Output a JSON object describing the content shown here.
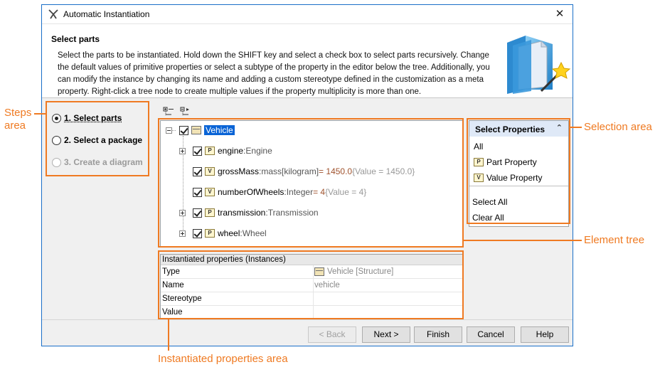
{
  "window": {
    "title": "Automatic Instantiation",
    "close": "✕"
  },
  "header": {
    "title": "Select parts",
    "description": "Select the parts to be instantiated. Hold down the SHIFT key and select a check box to select parts recursively. Change the default values of primitive properties or select a subtype of the property in the editor below the tree. Additionally, you can modify the instance by changing its name and adding a custom stereotype defined in the customization as a meta property. Right-click a tree node to create multiple values if the property multiplicity is more than one."
  },
  "steps": [
    {
      "label": "1. Select parts",
      "selected": true,
      "enabled": true
    },
    {
      "label": "2. Select a package",
      "selected": false,
      "enabled": true
    },
    {
      "label": "3. Create a diagram",
      "selected": false,
      "enabled": false
    }
  ],
  "toolbar": {
    "expand_icon": "expand-all-icon",
    "collapse_icon": "collapse-all-icon"
  },
  "tree": {
    "root": {
      "name": "Vehicle",
      "checked": true,
      "expanded": true
    },
    "nodes": [
      {
        "name": "engine",
        "sep": " : ",
        "type": "Engine",
        "icon": "P",
        "expandable": true,
        "value": "",
        "hint": ""
      },
      {
        "name": "grossMass",
        "sep": " : ",
        "type": "mass[kilogram]",
        "icon": "V",
        "expandable": false,
        "value": " = 1450.0",
        "hint": " {Value = 1450.0}"
      },
      {
        "name": "numberOfWheels",
        "sep": " : ",
        "type": "Integer",
        "icon": "V",
        "expandable": false,
        "value": " = 4",
        "hint": " {Value = 4}"
      },
      {
        "name": "transmission",
        "sep": " : ",
        "type": "Transmission",
        "icon": "P",
        "expandable": true,
        "value": "",
        "hint": ""
      },
      {
        "name": "wheel",
        "sep": " : ",
        "type": "Wheel",
        "icon": "P",
        "expandable": true,
        "value": "",
        "hint": ""
      }
    ]
  },
  "selection": {
    "title": "Select Properties",
    "collapse": "⌃",
    "items": [
      "All",
      "Part Property",
      "Value Property"
    ],
    "item_icons": [
      "",
      "P",
      "V"
    ],
    "actions": [
      "Select All",
      "Clear All"
    ]
  },
  "properties": {
    "header": "Instantiated properties (Instances)",
    "rows": [
      {
        "key": "Type",
        "value": "Vehicle [Structure]"
      },
      {
        "key": "Name",
        "value": "vehicle"
      },
      {
        "key": "Stereotype",
        "value": ""
      },
      {
        "key": "Value",
        "value": ""
      }
    ]
  },
  "buttons": {
    "back": "< Back",
    "next": "Next >",
    "finish": "Finish",
    "cancel": "Cancel",
    "help": "Help"
  },
  "annotations": {
    "steps_area": [
      "Steps",
      "area"
    ],
    "selection_area": "Selection area",
    "element_tree": "Element tree",
    "instantiated_area": "Instantiated properties area"
  },
  "colors": {
    "accent": "#ef7a22",
    "selection_blue": "#0a64d6",
    "window_border": "#1a6fc8"
  }
}
